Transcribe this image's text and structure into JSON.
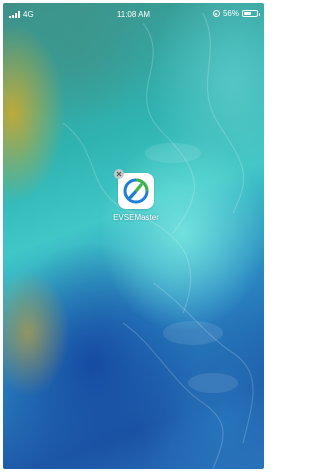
{
  "status_bar": {
    "carrier": "4G",
    "time": "11:08 AM",
    "battery_text": "56%",
    "battery_level": 0.56,
    "icons": [
      "signal-icon",
      "orientation-lock-icon",
      "battery-icon"
    ]
  },
  "home_screen": {
    "apps": [
      {
        "label": "EVSEMaster",
        "icon": "evsemaster-app-icon",
        "brand_colors": [
          "#1e7fd8",
          "#3cb54a"
        ]
      }
    ],
    "wallpaper_colors": [
      "#d6aa28",
      "#3fc7c6",
      "#2a86c2",
      "#1d57a6"
    ]
  }
}
